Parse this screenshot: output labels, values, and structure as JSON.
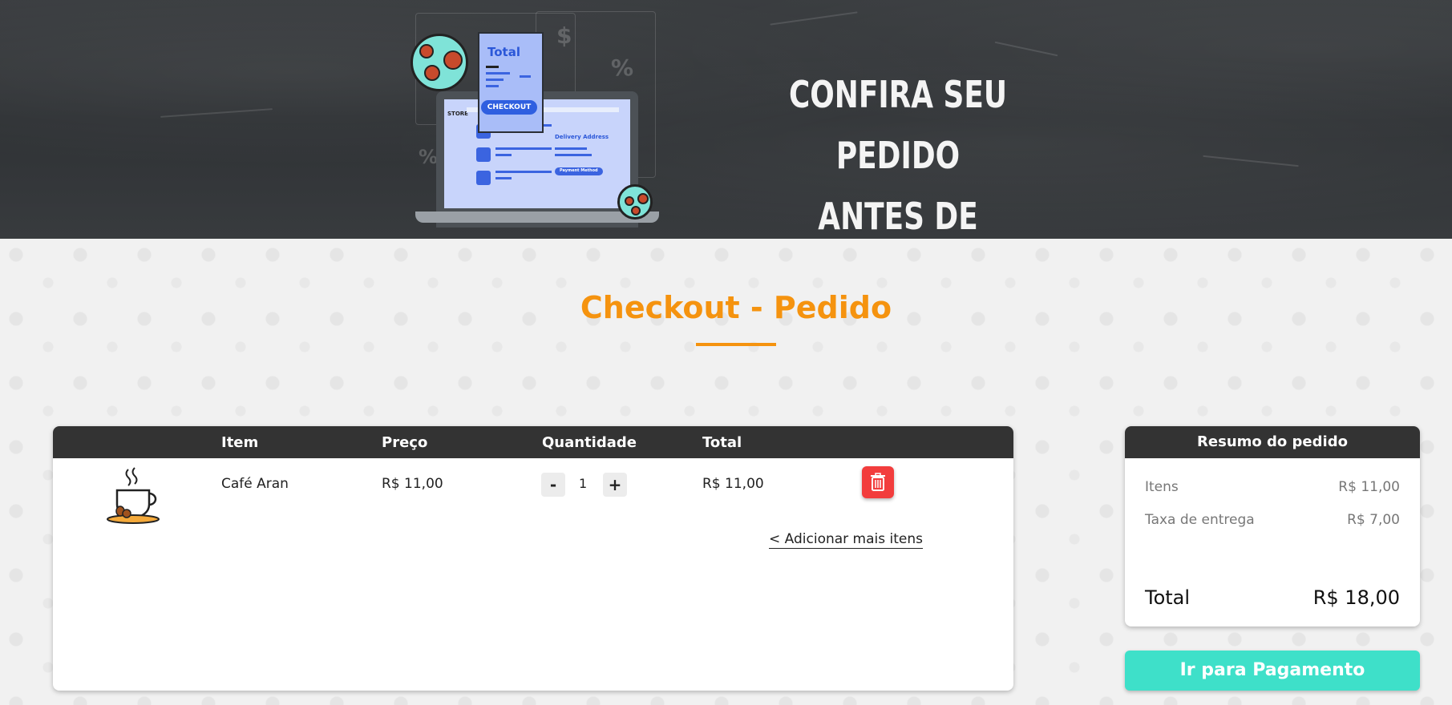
{
  "hero": {
    "line1": "CONFIRA SEU PEDIDO",
    "line2": "ANTES DE CONTINUAR",
    "illustration": {
      "receipt_title": "Total",
      "checkout_label": "CHECKOUT",
      "store_label": "STORE",
      "delivery_label": "Delivery Address",
      "payment_label": "Payment Method"
    }
  },
  "page": {
    "title": "Checkout - Pedido"
  },
  "cart": {
    "headers": {
      "item": "Item",
      "price": "Preço",
      "quantity": "Quantidade",
      "total": "Total"
    },
    "rows": [
      {
        "icon": "coffee-cup-icon",
        "name": "Café Aran",
        "price": "R$ 11,00",
        "quantity": "1",
        "total": "R$ 11,00"
      }
    ],
    "minus_label": "-",
    "plus_label": "+",
    "add_more": "< Adicionar mais itens"
  },
  "summary": {
    "title": "Resumo do pedido",
    "items_label": "Itens",
    "items_value": "R$ 11,00",
    "fee_label": "Taxa de entrega",
    "fee_value": "R$ 7,00",
    "total_label": "Total",
    "total_value": "R$ 18,00"
  },
  "actions": {
    "pay_button": "Ir para Pagamento"
  },
  "colors": {
    "accent_orange": "#f5930f",
    "header_dark": "#333333",
    "pay_teal": "#3ee0c9",
    "delete_red": "#f23d3d"
  }
}
